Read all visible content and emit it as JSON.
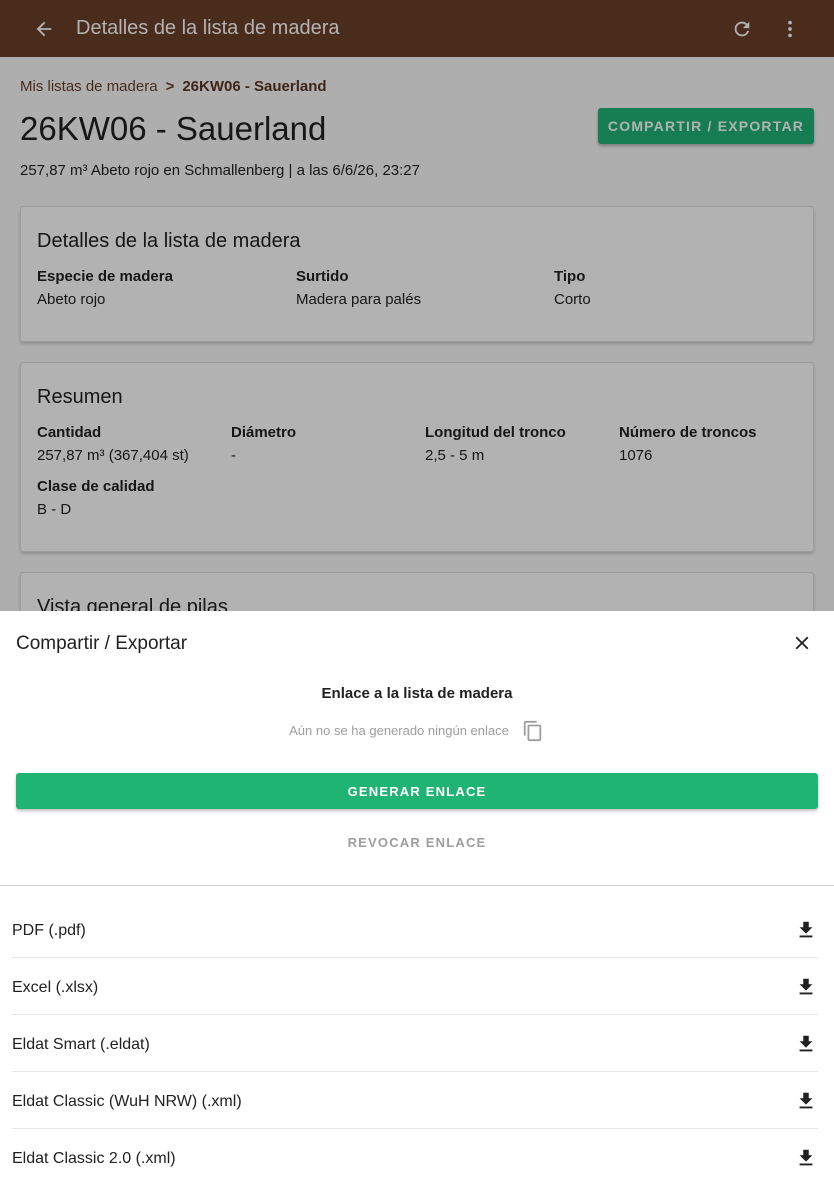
{
  "appbar": {
    "title": "Detalles de la lista de madera",
    "background": "#6b3f2a",
    "icons": [
      "arrow-back-icon",
      "refresh-icon",
      "more-vert-icon"
    ]
  },
  "breadcrumb": {
    "parent": "Mis listas de madera",
    "separator": ">",
    "current": "26KW06 - Sauerland"
  },
  "page": {
    "title": "26KW06 - Sauerland",
    "subtitle": "257,87 m³ Abeto rojo en Schmallenberg | a las 6/6/26, 23:27",
    "share_button": "COMPARTIR / EXPORTAR"
  },
  "details_card": {
    "title": "Detalles de la lista de madera",
    "fields": [
      {
        "label": "Especie de madera",
        "value": "Abeto rojo"
      },
      {
        "label": "Surtido",
        "value": "Madera para palés"
      },
      {
        "label": "Tipo",
        "value": "Corto"
      }
    ]
  },
  "summary_card": {
    "title": "Resumen",
    "fields": [
      {
        "label": "Cantidad",
        "value": "257,87 m³ (367,404 st)"
      },
      {
        "label": "Diámetro",
        "value": "-"
      },
      {
        "label": "Longitud del tronco",
        "value": "2,5 - 5 m"
      },
      {
        "label": "Número de troncos",
        "value": "1076"
      },
      {
        "label": "Clase de calidad",
        "value": "B - D"
      }
    ]
  },
  "piles_card": {
    "title": "Vista general de pilas"
  },
  "sheet": {
    "title": "Compartir / Exportar",
    "link_heading": "Enlace a la lista de madera",
    "link_placeholder": "Aún no se ha generado ningún enlace",
    "generate_button": "GENERAR ENLACE",
    "revoke_button": "REVOCAR ENLACE",
    "exports": [
      {
        "label": "PDF (.pdf)"
      },
      {
        "label": "Excel (.xlsx)"
      },
      {
        "label": "Eldat Smart (.eldat)"
      },
      {
        "label": "Eldat Classic (WuH NRW) (.xml)"
      },
      {
        "label": "Eldat Classic 2.0 (.xml)"
      }
    ]
  },
  "colors": {
    "primary_brown": "#6b3f2a",
    "accent_green": "#1fb374",
    "disabled_gray": "#9e9e9e"
  }
}
